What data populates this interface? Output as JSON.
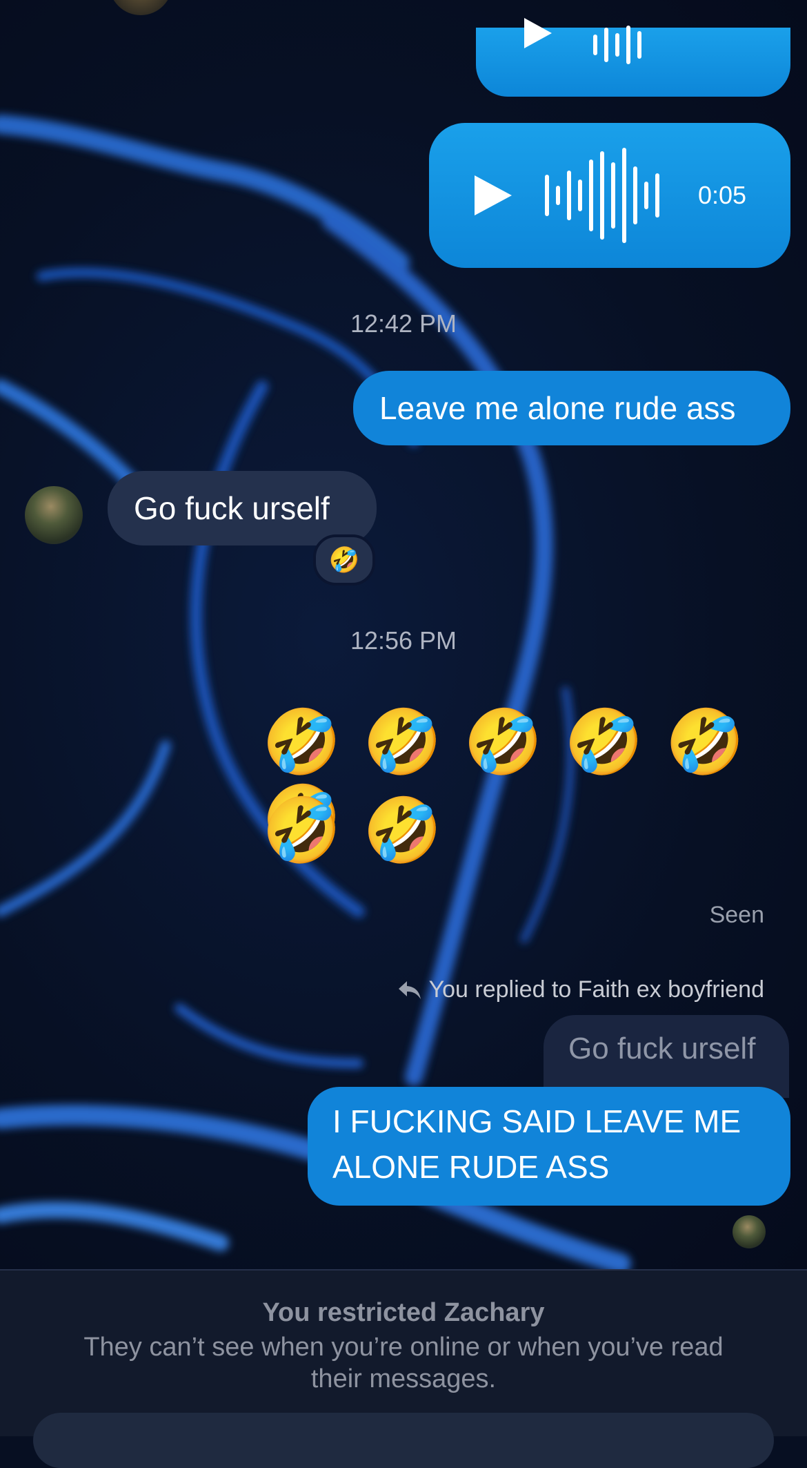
{
  "voice_messages": [
    {
      "duration": "0:05"
    }
  ],
  "timestamps": [
    "12:42 PM",
    "12:56 PM"
  ],
  "messages": {
    "outgoing_1": "Leave me alone rude ass",
    "incoming_1": "Go fuck urself",
    "incoming_1_reaction": "🤣",
    "emoji_row_1": "🤣 🤣 🤣 🤣 🤣 🤣",
    "emoji_row_2": "🤣 🤣",
    "seen": "Seen",
    "reply_note": "You replied to Faith ex boyfriend",
    "reply_quote": "Go fuck urself",
    "outgoing_2_line1": "I FUCKING SAID LEAVE ME",
    "outgoing_2_line2": "ALONE RUDE ASS"
  },
  "restriction": {
    "title": "You restricted Zachary",
    "body": "They can’t see when you’re online or when you’ve read their messages."
  },
  "colors": {
    "outgoing_bubble": "#1184d9",
    "incoming_bubble": "#24314d",
    "background": "#070f22"
  }
}
